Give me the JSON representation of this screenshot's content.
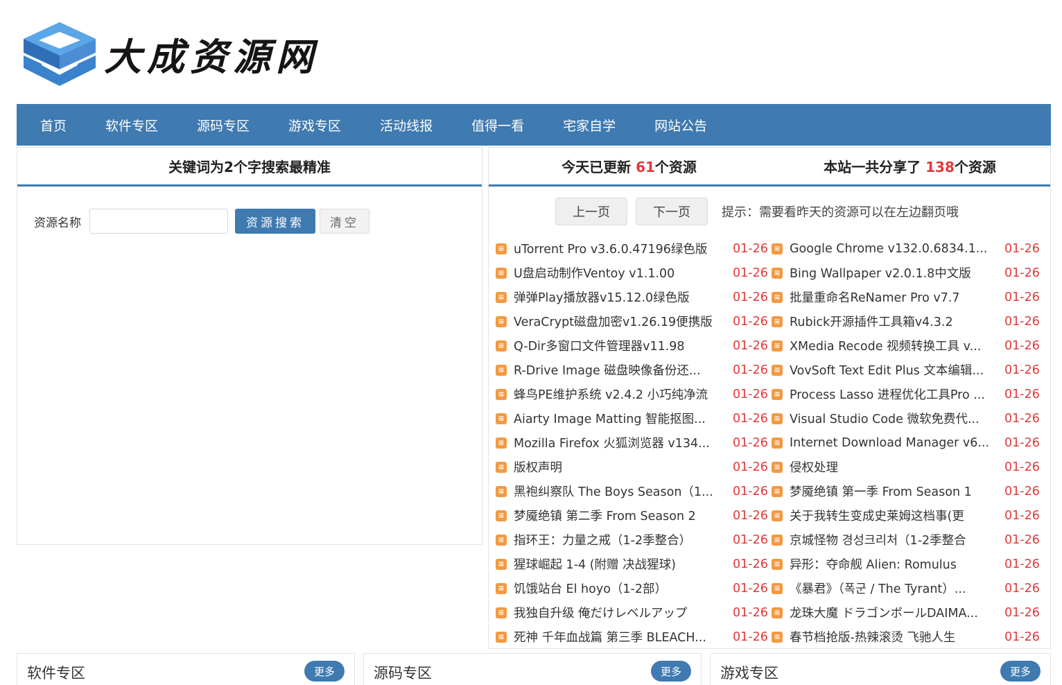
{
  "header": {
    "site_title": "大成资源网"
  },
  "nav": {
    "items": [
      "首页",
      "软件专区",
      "源码专区",
      "游戏专区",
      "活动线报",
      "值得一看",
      "宅家自学",
      "网站公告"
    ]
  },
  "search": {
    "heading": "关键词为2个字搜索最精准",
    "label": "资源名称",
    "input_value": "",
    "search_button": "资源搜索",
    "clear_button": "清空"
  },
  "stats": {
    "today_prefix": "今天已更新 ",
    "today_count": "61",
    "today_suffix": "个资源",
    "total_prefix": "本站一共分享了 ",
    "total_count": "138",
    "total_suffix": "个资源"
  },
  "pager": {
    "prev": "上一页",
    "next": "下一页",
    "hint": "提示：需要看昨天的资源可以在左边翻页哦"
  },
  "list": {
    "left": [
      {
        "title": "uTorrent Pro v3.6.0.47196绿色版",
        "date": "01-26"
      },
      {
        "title": "U盘启动制作Ventoy v1.1.00",
        "date": "01-26"
      },
      {
        "title": "弹弹Play播放器v15.12.0绿色版",
        "date": "01-26"
      },
      {
        "title": "VeraCrypt磁盘加密v1.26.19便携版",
        "date": "01-26"
      },
      {
        "title": "Q-Dir多窗口文件管理器v11.98",
        "date": "01-26"
      },
      {
        "title": "R-Drive Image 磁盘映像备份还...",
        "date": "01-26"
      },
      {
        "title": "蜂鸟PE维护系统 v2.4.2 小巧纯净流",
        "date": "01-26"
      },
      {
        "title": "Aiarty Image Matting 智能抠图...",
        "date": "01-26"
      },
      {
        "title": "Mozilla Firefox 火狐浏览器 v134...",
        "date": "01-26"
      },
      {
        "title": "版权声明",
        "date": "01-26"
      },
      {
        "title": "黑袍纠察队 The Boys Season（1...",
        "date": "01-26"
      },
      {
        "title": "梦魇绝镇 第二季 From Season 2",
        "date": "01-26"
      },
      {
        "title": "指环王：力量之戒（1-2季整合）",
        "date": "01-26"
      },
      {
        "title": "猩球崛起 1-4 (附赠 决战猩球)",
        "date": "01-26"
      },
      {
        "title": "饥饿站台 El hoyo（1-2部）",
        "date": "01-26"
      },
      {
        "title": "我独自升级 俺だけレベルアップ",
        "date": "01-26"
      },
      {
        "title": "死神 千年血战篇 第三季 BLEACH...",
        "date": "01-26"
      }
    ],
    "right": [
      {
        "title": "Google Chrome v132.0.6834.1...",
        "date": "01-26"
      },
      {
        "title": "Bing Wallpaper v2.0.1.8中文版",
        "date": "01-26"
      },
      {
        "title": "批量重命名ReNamer Pro v7.7",
        "date": "01-26"
      },
      {
        "title": "Rubick开源插件工具箱v4.3.2",
        "date": "01-26"
      },
      {
        "title": "XMedia Recode 视频转换工具 v...",
        "date": "01-26"
      },
      {
        "title": "VovSoft Text Edit Plus 文本编辑...",
        "date": "01-26"
      },
      {
        "title": "Process Lasso 进程优化工具Pro ...",
        "date": "01-26"
      },
      {
        "title": "Visual Studio Code 微软免费代...",
        "date": "01-26"
      },
      {
        "title": "Internet Download Manager v6...",
        "date": "01-26"
      },
      {
        "title": "侵权处理",
        "date": "01-26"
      },
      {
        "title": "梦魇绝镇 第一季 From Season 1",
        "date": "01-26"
      },
      {
        "title": "关于我转生变成史莱姆这档事(更",
        "date": "01-26"
      },
      {
        "title": "京城怪物 경성크리처（1-2季整合",
        "date": "01-26"
      },
      {
        "title": "异形：夺命舰 Alien: Romulus",
        "date": "01-26"
      },
      {
        "title": "《暴君》（폭군 / The Tyrant）...",
        "date": "01-26"
      },
      {
        "title": "龙珠大魔 ドラゴンボールDAIMA...",
        "date": "01-26"
      },
      {
        "title": "春节档抢版-热辣滚烫 飞驰人生",
        "date": "01-26"
      }
    ]
  },
  "categories": [
    {
      "title": "软件专区",
      "more": "更多"
    },
    {
      "title": "源码专区",
      "more": "更多"
    },
    {
      "title": "游戏专区",
      "more": "更多"
    }
  ],
  "colors": {
    "brand": "#3f7ab0",
    "accent_red": "#e03a3a",
    "icon_orange": "#f39a42"
  },
  "icons": {
    "logo": "blue-cube-logo",
    "list_item": "orange-doc-icon"
  }
}
